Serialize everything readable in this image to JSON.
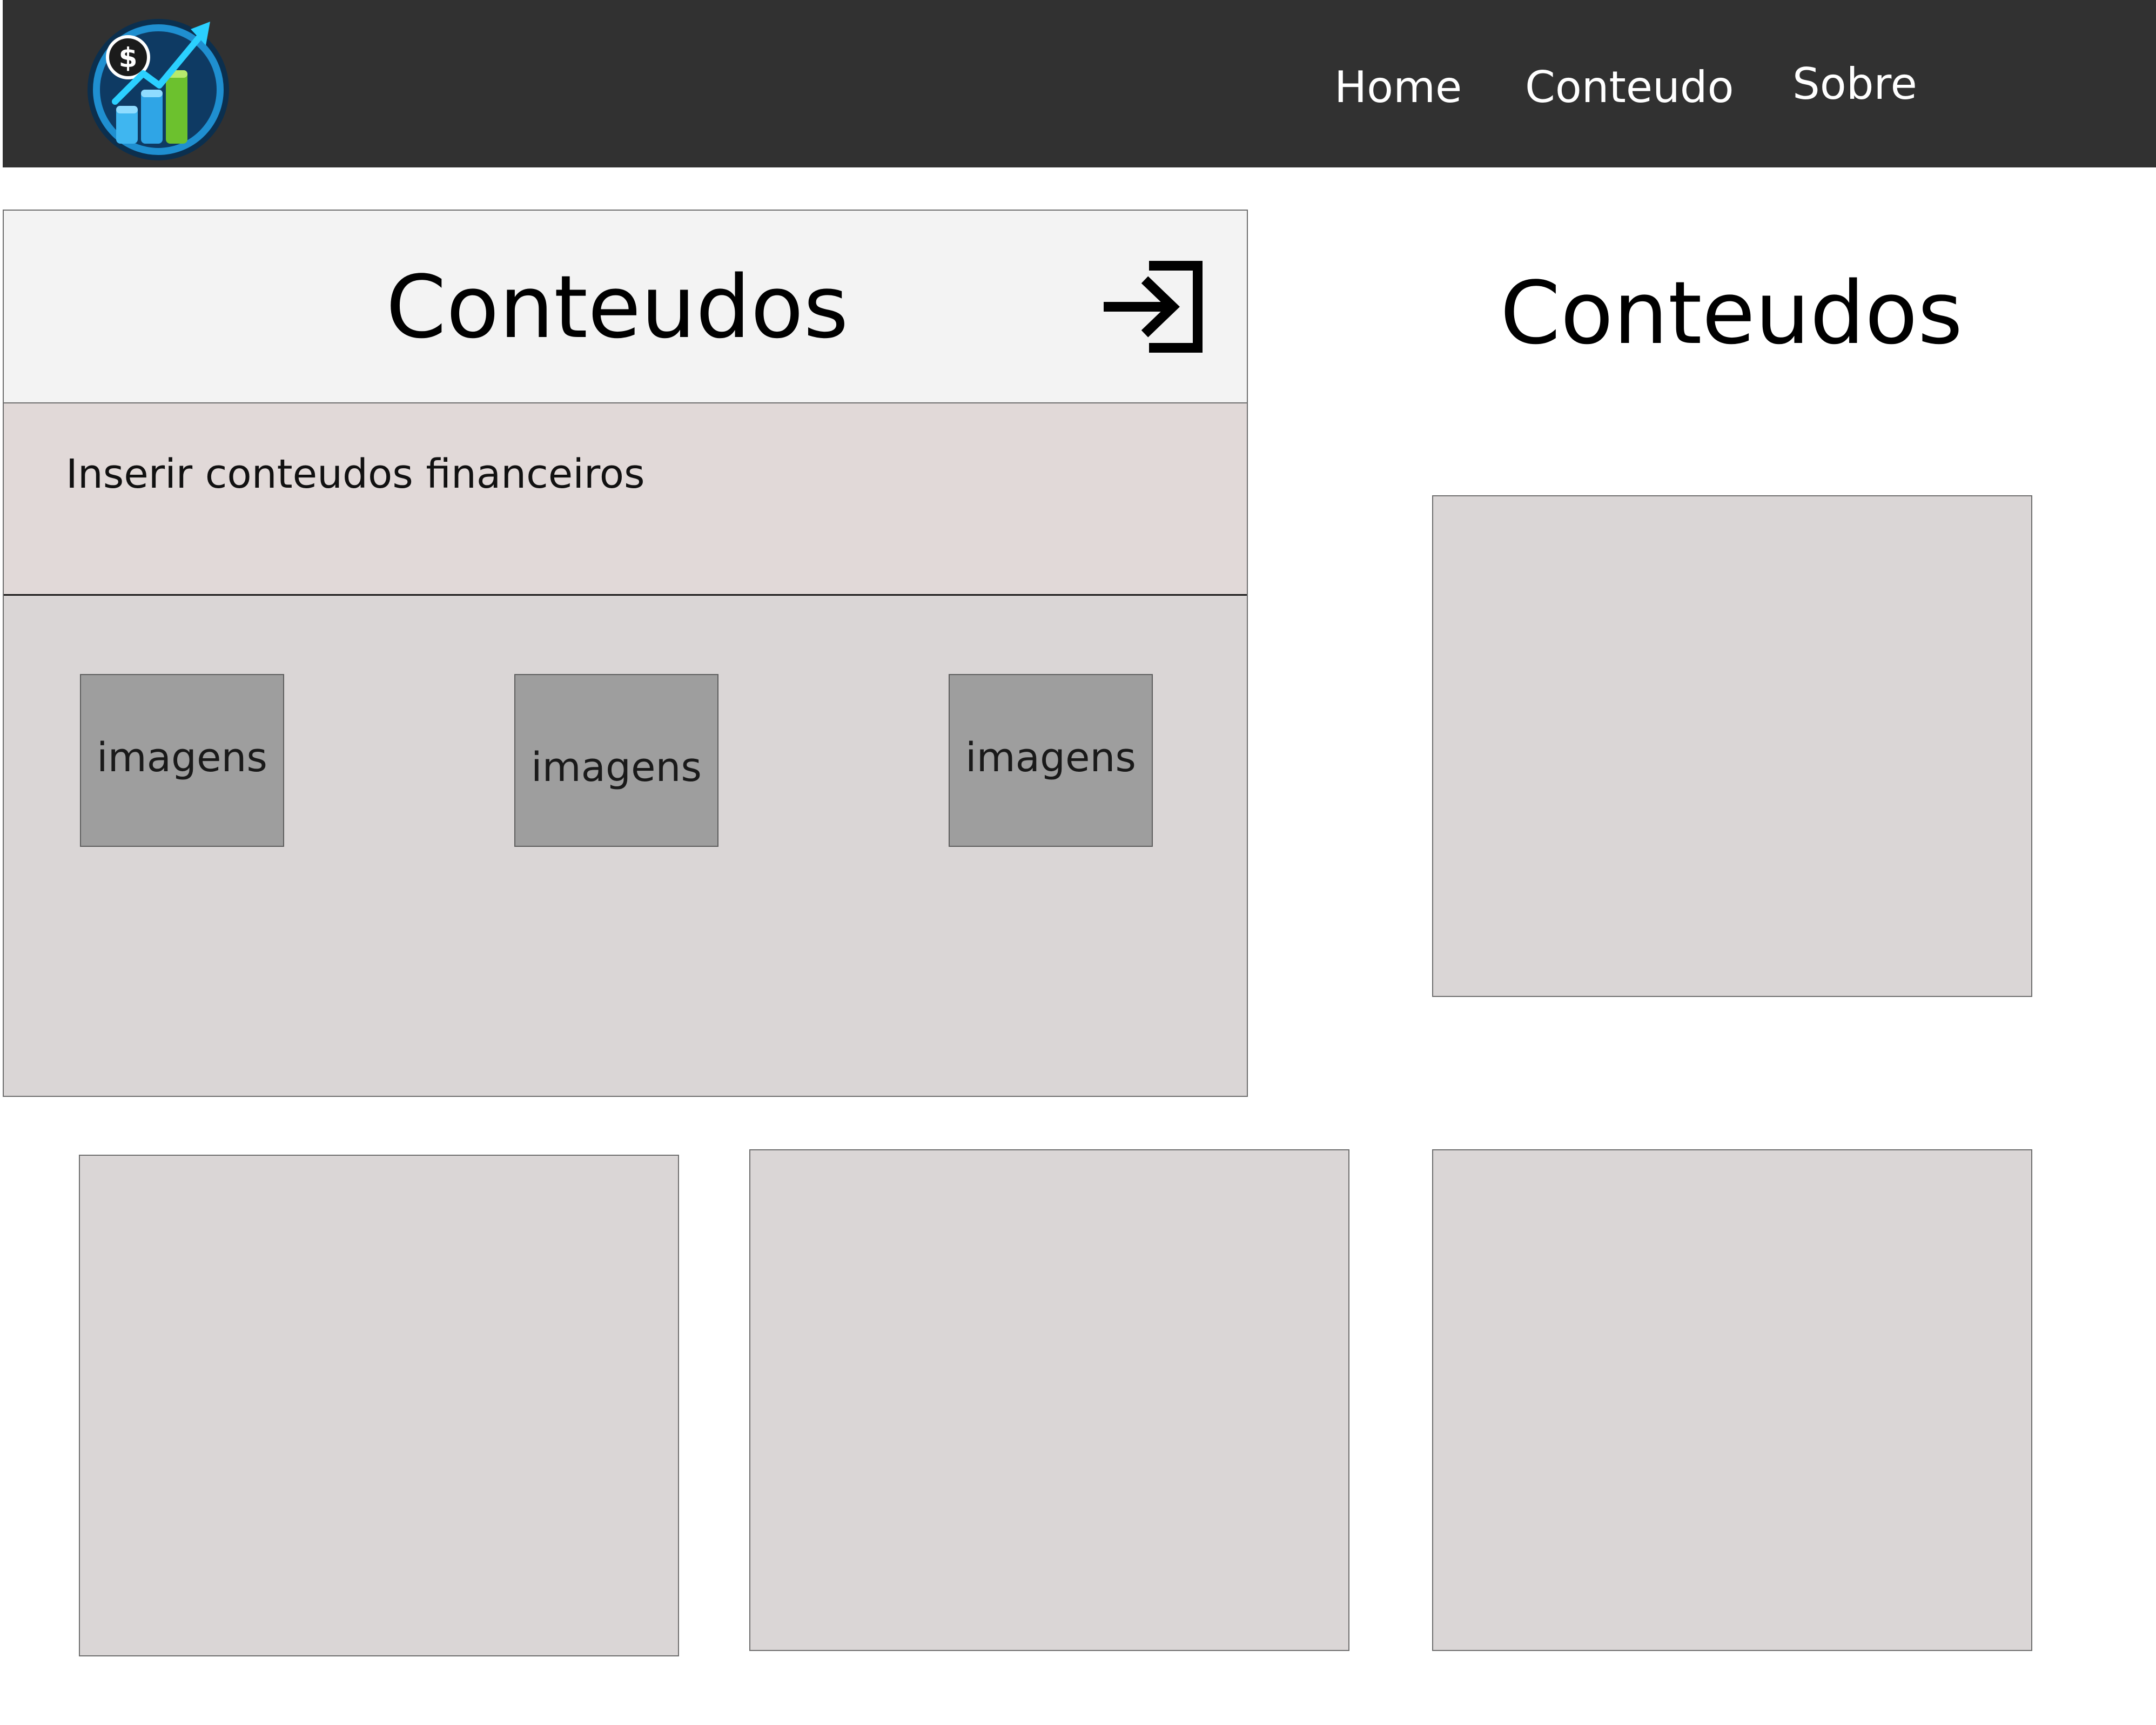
{
  "header": {
    "logo_icon": "finance-growth-logo-icon",
    "nav": [
      {
        "label": "Home"
      },
      {
        "label": "Conteudo"
      },
      {
        "label": "Sobre"
      }
    ],
    "background": "#313131"
  },
  "panel": {
    "title": "Conteudos",
    "action_icon": "login-arrow-icon",
    "subtitle": "Inserir conteudos financeiros",
    "images": [
      {
        "label": "imagens"
      },
      {
        "label": "imagens"
      },
      {
        "label": "imagens"
      }
    ]
  },
  "right": {
    "title": "Conteudos"
  },
  "colors": {
    "navbar": "#313131",
    "panel_header": "#f3f3f3",
    "panel_subheader": "#e1d9d8",
    "panel_body": "#dad6d6",
    "image_tile": "#9e9e9e",
    "card": "#dad6d6"
  }
}
